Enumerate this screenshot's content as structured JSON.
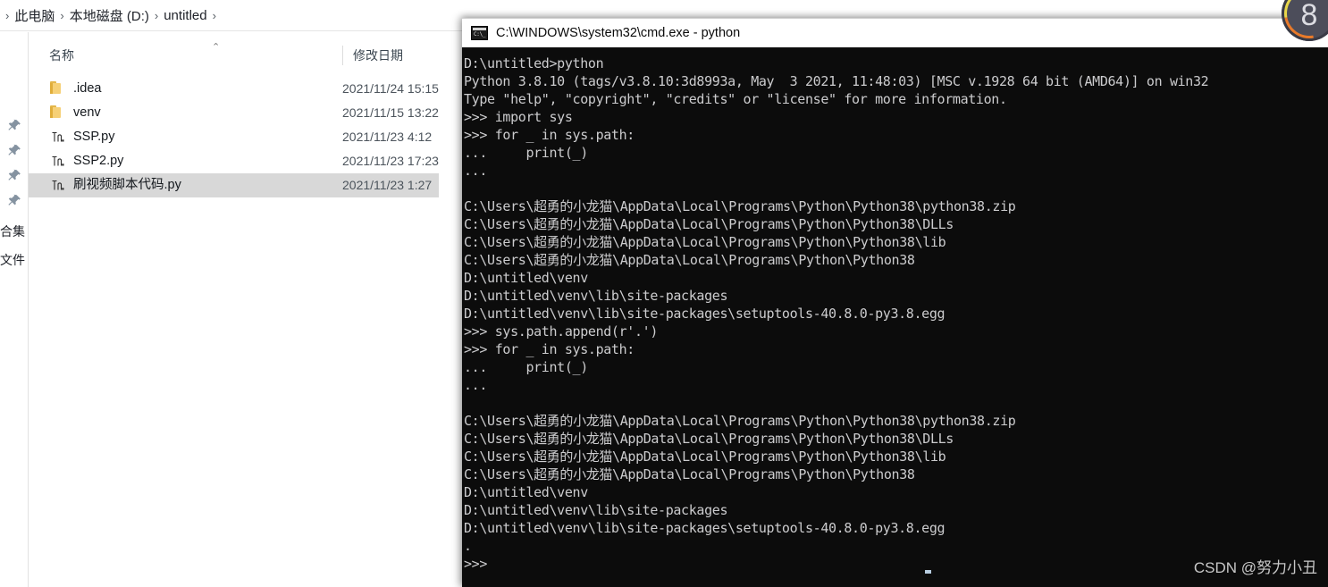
{
  "explorer": {
    "breadcrumb": {
      "leading_separator": "›",
      "items": [
        {
          "label": "此电脑",
          "separator": "›"
        },
        {
          "label": "本地磁盘 (D:)",
          "separator": "›"
        },
        {
          "label": "untitled",
          "separator": "›"
        }
      ]
    },
    "nav_rail": {
      "pin_icons": [
        "pin-icon",
        "pin-icon",
        "pin-icon",
        "pin-icon"
      ],
      "clipped_labels": [
        "合集",
        "文件"
      ]
    },
    "columns": {
      "name": "名称",
      "date_modified": "修改日期",
      "sort_caret": "⌃"
    },
    "files": [
      {
        "icon": "folder-icon",
        "name": ".idea",
        "date": "2021/11/24 15:15",
        "selected": false
      },
      {
        "icon": "folder-icon",
        "name": "venv",
        "date": "2021/11/15 13:22",
        "selected": false
      },
      {
        "icon": "python-file-icon",
        "name": "SSP.py",
        "date": "2021/11/23 4:12",
        "selected": false
      },
      {
        "icon": "python-file-icon",
        "name": "SSP2.py",
        "date": "2021/11/23 17:23",
        "selected": false
      },
      {
        "icon": "python-file-icon",
        "name": "刷视频脚本代码.py",
        "date": "2021/11/23 1:27",
        "selected": true
      }
    ]
  },
  "terminal": {
    "icon": "cmd-icon",
    "icon_text": "C:\\_",
    "title": "C:\\WINDOWS\\system32\\cmd.exe - python",
    "lines": [
      "D:\\untitled>python",
      "Python 3.8.10 (tags/v3.8.10:3d8993a, May  3 2021, 11:48:03) [MSC v.1928 64 bit (AMD64)] on win32",
      "Type \"help\", \"copyright\", \"credits\" or \"license\" for more information.",
      ">>> import sys",
      ">>> for _ in sys.path:",
      "...     print(_)",
      "...",
      "",
      "C:\\Users\\超勇的小龙猫\\AppData\\Local\\Programs\\Python\\Python38\\python38.zip",
      "C:\\Users\\超勇的小龙猫\\AppData\\Local\\Programs\\Python\\Python38\\DLLs",
      "C:\\Users\\超勇的小龙猫\\AppData\\Local\\Programs\\Python\\Python38\\lib",
      "C:\\Users\\超勇的小龙猫\\AppData\\Local\\Programs\\Python\\Python38",
      "D:\\untitled\\venv",
      "D:\\untitled\\venv\\lib\\site-packages",
      "D:\\untitled\\venv\\lib\\site-packages\\setuptools-40.8.0-py3.8.egg",
      ">>> sys.path.append(r'.')",
      ">>> for _ in sys.path:",
      "...     print(_)",
      "...",
      "",
      "C:\\Users\\超勇的小龙猫\\AppData\\Local\\Programs\\Python\\Python38\\python38.zip",
      "C:\\Users\\超勇的小龙猫\\AppData\\Local\\Programs\\Python\\Python38\\DLLs",
      "C:\\Users\\超勇的小龙猫\\AppData\\Local\\Programs\\Python\\Python38\\lib",
      "C:\\Users\\超勇的小龙猫\\AppData\\Local\\Programs\\Python\\Python38",
      "D:\\untitled\\venv",
      "D:\\untitled\\venv\\lib\\site-packages",
      "D:\\untitled\\venv\\lib\\site-packages\\setuptools-40.8.0-py3.8.egg",
      ".",
      ">>>"
    ],
    "watermark": "CSDN @努力小丑"
  },
  "corner_badge": {
    "value": "8"
  },
  "colors": {
    "terminal_bg": "#0c0c0c",
    "terminal_fg": "#ccccce",
    "titlebar_bg": "#ffffff",
    "selection_bg": "#d8d8d8",
    "folder_yellow": "#f6d076"
  }
}
